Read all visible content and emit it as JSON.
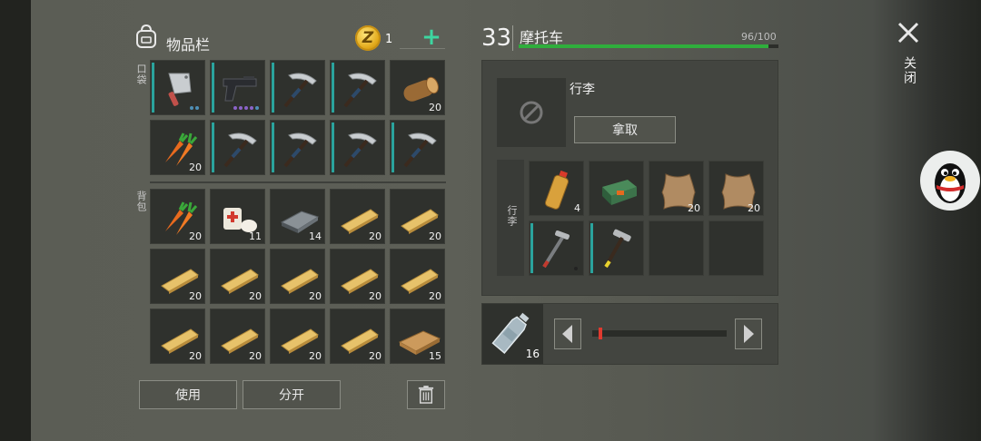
{
  "header": {
    "title": "物品栏",
    "coin_count": "1",
    "coin_symbol": "Z",
    "add_icon": "plus-icon",
    "bag_icon": "backpack-icon"
  },
  "pockets": {
    "label": "口袋",
    "items": [
      {
        "icon": "cleaver-icon",
        "qty": "",
        "dots": [
          "#4f8fb6",
          "#4f8fb6"
        ],
        "bar": true
      },
      {
        "icon": "pistol-icon",
        "qty": "",
        "dots": [
          "#8b63c9",
          "#8b63c9",
          "#8b63c9",
          "#8b63c9",
          "#4f8fb6"
        ],
        "bar": true
      },
      {
        "icon": "pickaxe-icon",
        "qty": "",
        "bar": true
      },
      {
        "icon": "pickaxe-icon",
        "qty": "",
        "bar": true
      },
      {
        "icon": "log-icon",
        "qty": "20",
        "bar": false
      },
      {
        "icon": "carrot-icon",
        "qty": "20",
        "bar": false
      },
      {
        "icon": "pickaxe-icon",
        "qty": "",
        "bar": true
      },
      {
        "icon": "pickaxe-icon",
        "qty": "",
        "bar": true
      },
      {
        "icon": "pickaxe-icon",
        "qty": "",
        "bar": true
      },
      {
        "icon": "pickaxe-icon",
        "qty": "",
        "bar": true
      }
    ]
  },
  "backpack": {
    "label": "背包",
    "items": [
      {
        "icon": "carrot-icon",
        "qty": "20"
      },
      {
        "icon": "bandage-icon",
        "qty": "11"
      },
      {
        "icon": "iron-bar-icon",
        "qty": "14"
      },
      {
        "icon": "plank-icon",
        "qty": "20"
      },
      {
        "icon": "plank-icon",
        "qty": "20"
      },
      {
        "icon": "plank-icon",
        "qty": "20"
      },
      {
        "icon": "plank-icon",
        "qty": "20"
      },
      {
        "icon": "plank-icon",
        "qty": "20"
      },
      {
        "icon": "plank-icon",
        "qty": "20"
      },
      {
        "icon": "plank-icon",
        "qty": "20"
      },
      {
        "icon": "plank-icon",
        "qty": "20"
      },
      {
        "icon": "plank-icon",
        "qty": "20"
      },
      {
        "icon": "plank-icon",
        "qty": "20"
      },
      {
        "icon": "plank-icon",
        "qty": "20"
      },
      {
        "icon": "wood-board-icon",
        "qty": "15"
      }
    ]
  },
  "actions": {
    "use_label": "使用",
    "split_label": "分开",
    "trash_icon": "trash-icon"
  },
  "vehicle": {
    "level": "33",
    "name": "摩托车",
    "hp_text": "96/100",
    "hp_fraction": 0.96,
    "hp_color": "#2fae3c"
  },
  "trunk": {
    "title": "行李",
    "side_label": "行李",
    "take_label": "拿取",
    "empty_slot_icon": "blocked-icon",
    "items": [
      {
        "icon": "gas-bottle-icon",
        "qty": "4",
        "bar": false
      },
      {
        "icon": "toolbox-icon",
        "qty": "",
        "bar": false
      },
      {
        "icon": "leather-icon",
        "qty": "20",
        "bar": false
      },
      {
        "icon": "leather-icon",
        "qty": "20",
        "bar": false
      },
      {
        "icon": "crowbar-hammer-icon",
        "qty": "",
        "bar": true,
        "dots": [
          "#222222"
        ]
      },
      {
        "icon": "hammer-icon",
        "qty": "",
        "bar": true
      },
      {
        "icon": "",
        "qty": "",
        "bar": false
      },
      {
        "icon": "",
        "qty": "",
        "bar": false
      }
    ]
  },
  "transfer": {
    "item_icon": "water-bottle-icon",
    "qty": "16",
    "slider_fraction": 0.05,
    "left_icon": "arrow-left-icon",
    "right_icon": "arrow-right-icon"
  },
  "close": {
    "label": "关闭",
    "icon": "close-icon"
  },
  "floating": {
    "icon": "qq-penguin-icon"
  },
  "colors": {
    "accent": "#3dd6a0",
    "durability_bar": "#2aa39d",
    "coin": "#e2a91a"
  }
}
